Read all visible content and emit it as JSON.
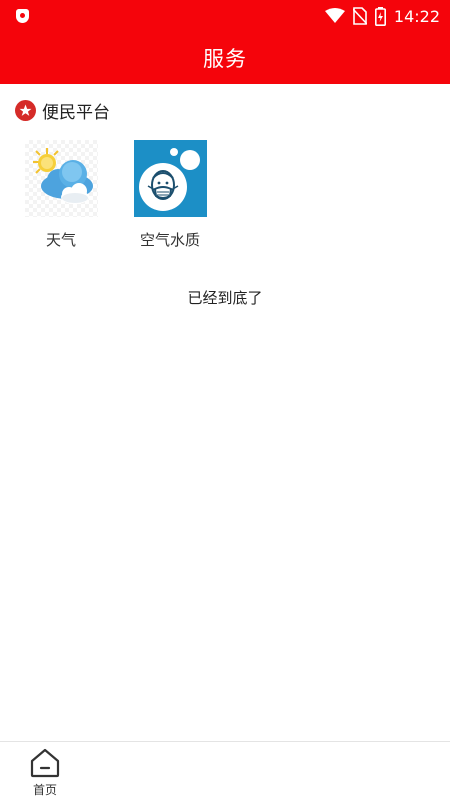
{
  "status_bar": {
    "time": "14:22",
    "icons": [
      "shield-icon",
      "wifi-icon",
      "no-sim-icon",
      "battery-charging-icon"
    ]
  },
  "header": {
    "title": "服务"
  },
  "section": {
    "title": "便民平台",
    "icon": "star-icon"
  },
  "services": [
    {
      "label": "天气",
      "icon": "weather-cloud-sun-icon"
    },
    {
      "label": "空气水质",
      "icon": "air-quality-mask-icon"
    }
  ],
  "end_text": "已经到底了",
  "bottom_nav": {
    "items": [
      {
        "label": "首页",
        "icon": "home-icon"
      }
    ]
  },
  "colors": {
    "brand_red": "#f5040b",
    "section_star": "#d52b28",
    "air_quality_bg": "#1c8fc6"
  }
}
